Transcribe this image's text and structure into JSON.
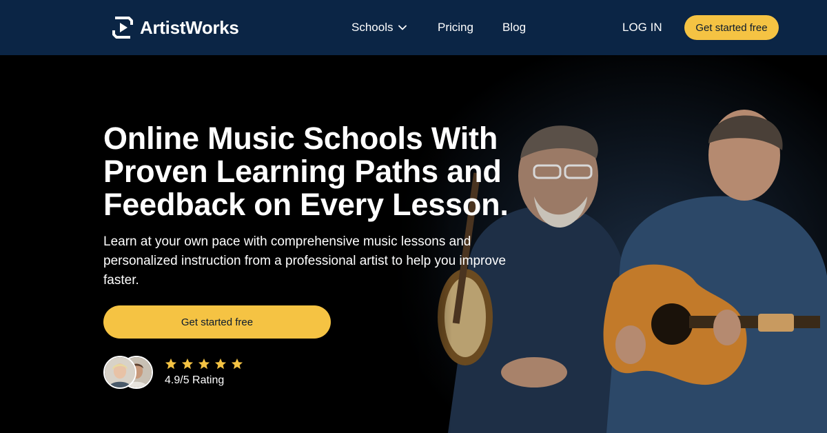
{
  "header": {
    "logo_text": "ArtistWorks",
    "nav": {
      "schools": "Schools",
      "pricing": "Pricing",
      "blog": "Blog",
      "login": "LOG IN"
    },
    "cta": "Get started free"
  },
  "hero": {
    "headline_lines": [
      "Online Music Schools With",
      "Proven Learning Paths and",
      "Feedback on Every Lesson."
    ],
    "subtext": "Learn at your own pace with comprehensive music lessons and personalized instruction from a professional artist to help you improve faster.",
    "cta": "Get started free",
    "rating": {
      "stars": 5,
      "label": "4.9/5 Rating"
    }
  },
  "colors": {
    "nav_bg": "#0b2545",
    "accent": "#f5c343",
    "hero_bg": "#000000"
  },
  "icons": [
    "artistworks-logo-icon",
    "chevron-down-icon",
    "star-icon"
  ]
}
